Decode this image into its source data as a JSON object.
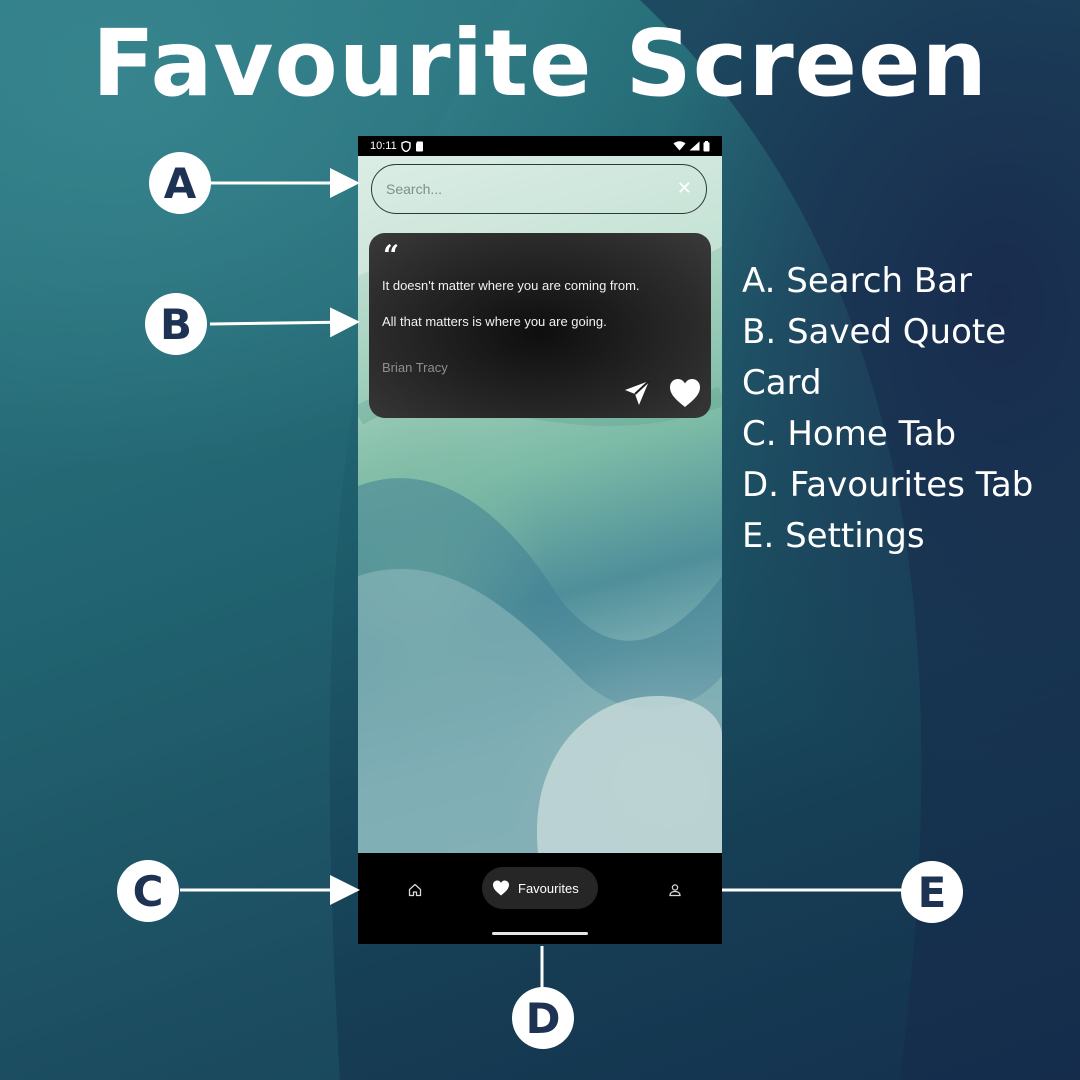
{
  "title": "Favourite Screen",
  "status_bar": {
    "time": "10:11"
  },
  "search": {
    "placeholder": "Search...",
    "clear_icon": "close-icon"
  },
  "quote_card": {
    "line1": "It doesn't matter where you are coming from.",
    "line2": "All that matters is where you are going.",
    "author": "Brian Tracy"
  },
  "nav": {
    "home_icon": "home-icon",
    "favourites_label": "Favourites",
    "settings_icon": "person-icon"
  },
  "callouts": {
    "a": "A",
    "b": "B",
    "c": "C",
    "d": "D",
    "e": "E"
  },
  "legend": {
    "items": [
      "A. Search Bar",
      "B. Saved Quote",
      "Card",
      "C. Home Tab",
      "D. Favourites Tab",
      "E. Settings"
    ]
  },
  "colors": {
    "callout_text": "#1e3353",
    "card_bg": "#1c1c1c",
    "nav_bg": "#000000"
  }
}
